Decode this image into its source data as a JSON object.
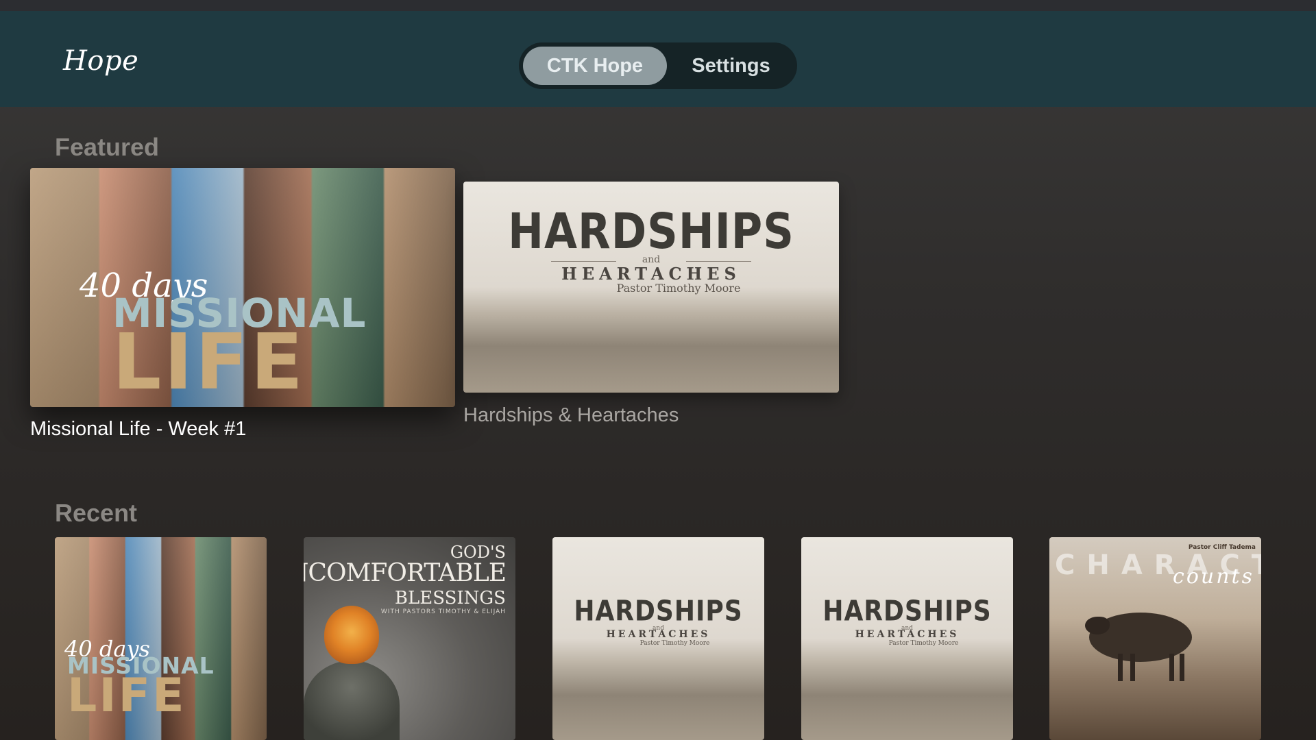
{
  "header": {
    "logo_text": "Hope",
    "tabs": [
      {
        "label": "CTK Hope",
        "active": true
      },
      {
        "label": "Settings",
        "active": false
      }
    ]
  },
  "featured": {
    "title": "Featured",
    "items": [
      {
        "caption": "Missional Life - Week #1",
        "focused": true,
        "art": {
          "days": "40 days",
          "line1": "MISSIONAL",
          "line2": "LIFE"
        }
      },
      {
        "caption": "Hardships & Heartaches",
        "focused": false,
        "art": {
          "title": "HARDSHIPS",
          "and": "and",
          "subtitle": "HEARTACHES",
          "pastor": "Pastor Timothy Moore"
        }
      }
    ]
  },
  "recent": {
    "title": "Recent",
    "items": [
      {
        "art": {
          "days": "40 days",
          "line1": "MISSIONAL",
          "line2": "LIFE"
        }
      },
      {
        "art": {
          "line1": "GOD'S",
          "line2": "UNCOMFORTABLE",
          "line3": "BLESSINGS",
          "small": "WITH PASTORS TIMOTHY & ELIJAH"
        }
      },
      {
        "art": {
          "title": "HARDSHIPS",
          "and": "and",
          "subtitle": "HEARTACHES",
          "pastor": "Pastor Timothy Moore"
        }
      },
      {
        "art": {
          "title": "HARDSHIPS",
          "and": "and",
          "subtitle": "HEARTACHES",
          "pastor": "Pastor Timothy Moore"
        }
      },
      {
        "art": {
          "pastor": "Pastor Cliff Tadema",
          "title": "CHARACTER",
          "subtitle": "counts"
        }
      }
    ]
  },
  "colors": {
    "header_bg": "#1f3a41",
    "tab_active_bg": "#8f9ca0",
    "section_title": "#8b8884"
  }
}
